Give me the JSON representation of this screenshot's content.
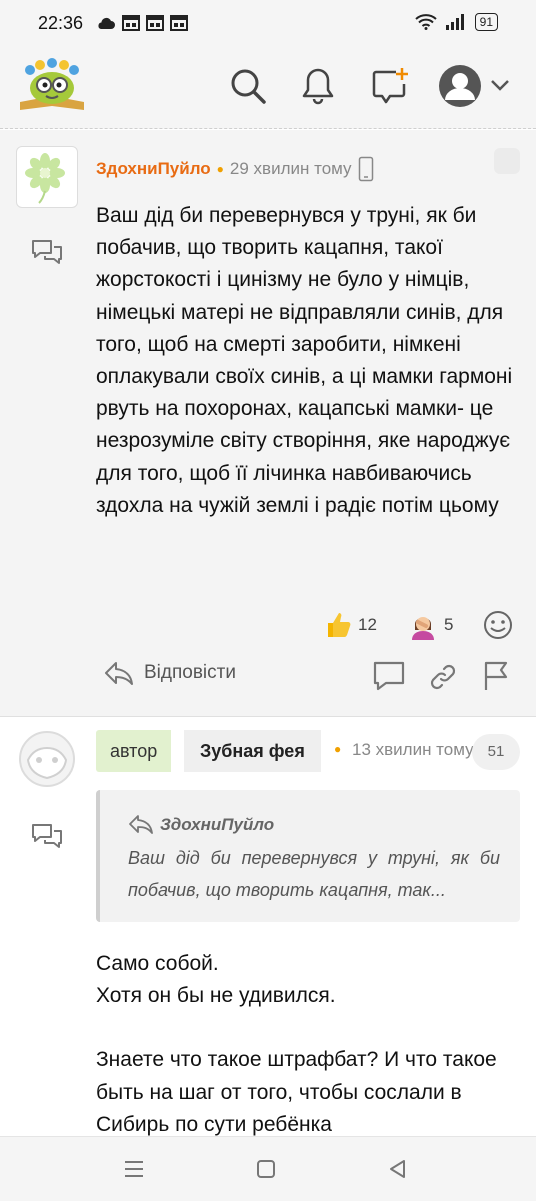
{
  "status_bar": {
    "time": "22:36",
    "battery": "91"
  },
  "comments": [
    {
      "author": "ЗдохниПуйло",
      "time": "29 хвилин тому",
      "text": "Ваш дід би перевернувся у труні, як би побачив, що творить кацапня, такої жорстокості і цинізму не було у німців, німецькі матері не відправляли синів, для того, щоб на смерті заробити, німкені оплакували своїх синів, а ці мамки гармоні рвуть на похоронах, кацапські мамки- це незрозуміле світу створіння, яке народжує для того, щоб її лічинка навбиваючись здохла на чужій землі і радіє потім цьому",
      "reactions": [
        {
          "icon": "thumbs-up-icon",
          "count": "12"
        },
        {
          "icon": "facepalm-icon",
          "count": "5"
        }
      ],
      "reply_label": "Відповісти"
    },
    {
      "author_badge": "автор",
      "author": "Зубная фея",
      "time": "13 хвилин тому",
      "count": "51",
      "quote": {
        "author": "ЗдохниПуйло",
        "text": "Ваш дід би перевернувся у труні, як би побачив, що творить кацапня, так..."
      },
      "paragraphs": [
        "Само собой.\nХотя он бы не удивился.",
        "Знаете что такое штрафбат? И что такое быть на шаг от того, чтобы сослали в Сибирь по сути ребёнка"
      ]
    }
  ],
  "colors": {
    "accent": "#e86b13",
    "author_badge": "#e2f1cf"
  }
}
